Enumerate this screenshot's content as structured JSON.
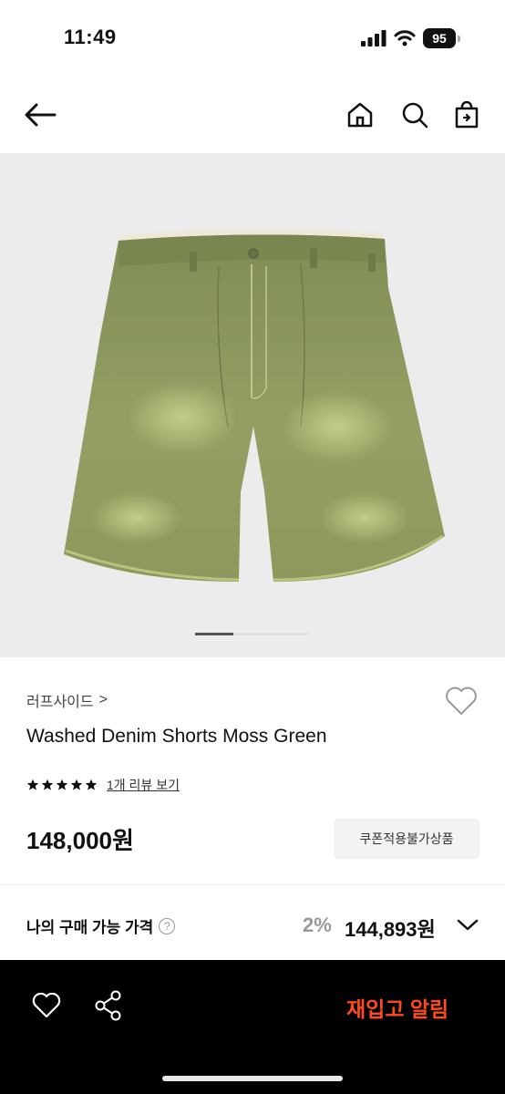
{
  "status_bar": {
    "time": "11:49",
    "battery": "95"
  },
  "header": {
    "back_icon": "arrow-left-icon",
    "home_icon": "home-icon",
    "search_icon": "search-icon",
    "bag_icon": "shopping-bag-icon"
  },
  "product": {
    "brand": "러프사이드",
    "brand_chevron": ">",
    "title": "Washed Denim Shorts Moss Green",
    "rating_stars": 5,
    "review_link": "1개 리뷰 보기",
    "price": "148,000원",
    "coupon_note": "쿠폰적용불가상품",
    "image_count": 3,
    "image_index": 1,
    "colors": {
      "shorts": "#8e9a5e",
      "image_bg": "#ececec"
    }
  },
  "my_price": {
    "label": "나의 구매 가능 가격",
    "help_icon": "?",
    "discount": "2%",
    "final_price": "144,893원"
  },
  "bottom_bar": {
    "restock_label": "재입고 알림",
    "accent": "#ff4a1c"
  }
}
